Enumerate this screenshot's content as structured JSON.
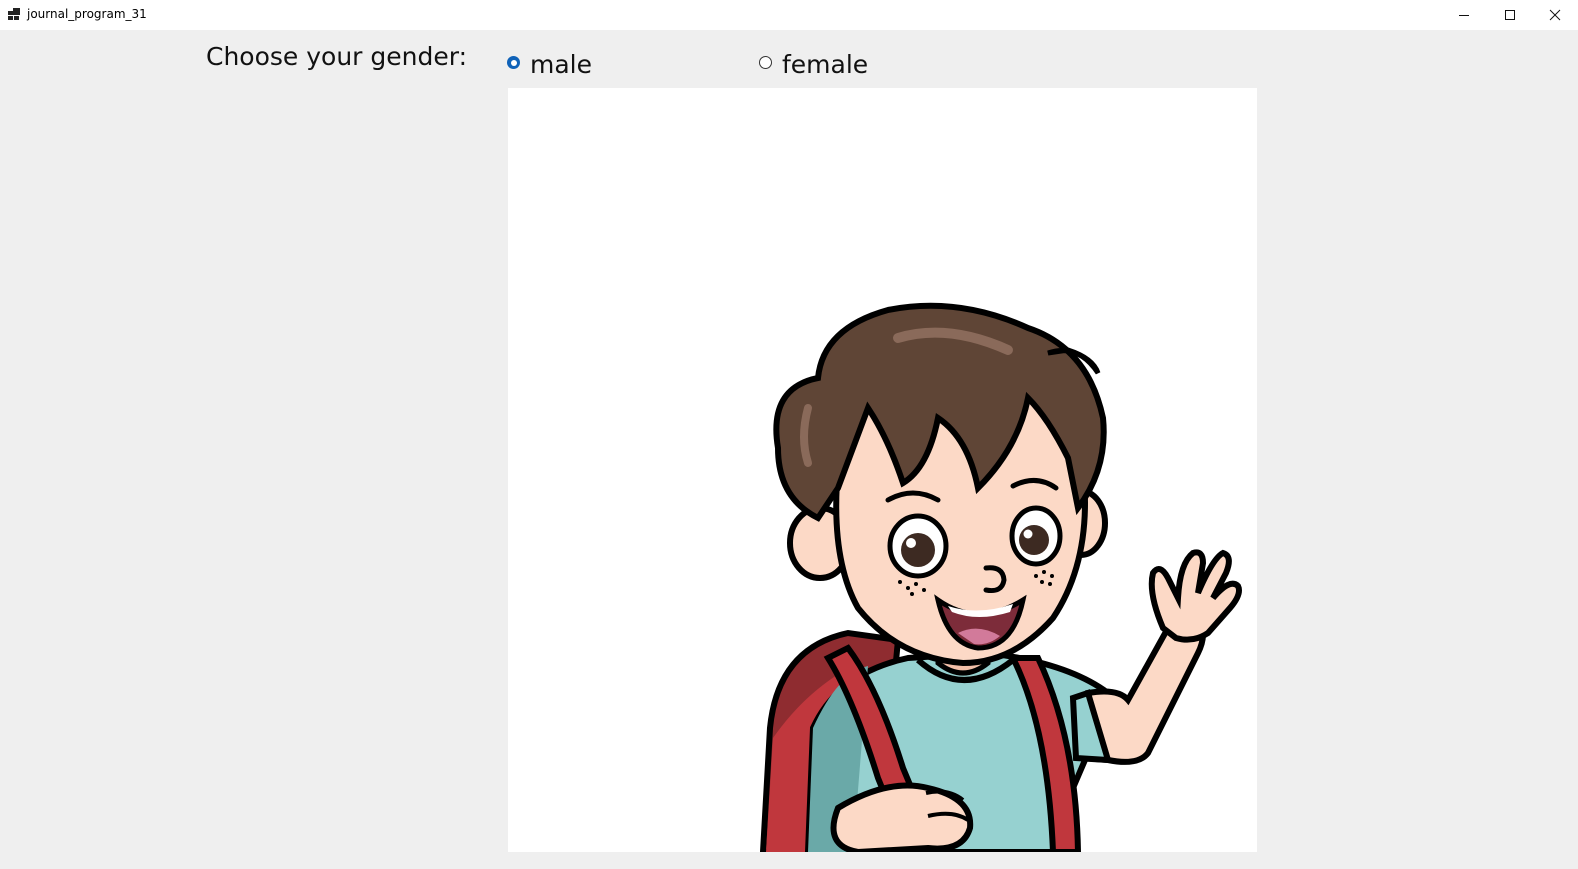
{
  "window": {
    "title": "journal_program_31",
    "icon": "app-icon"
  },
  "form": {
    "gender_label": "Choose your gender:",
    "options": [
      {
        "label": "male",
        "checked": true
      },
      {
        "label": "female",
        "checked": false
      }
    ]
  },
  "picture": {
    "description_icon": "cartoon-boy-waving-icon"
  },
  "colors": {
    "background": "#efefef",
    "radio_accent": "#0f62b8",
    "titlebar": "#ffffff"
  }
}
